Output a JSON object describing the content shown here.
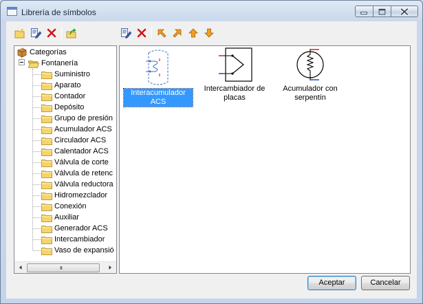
{
  "window": {
    "title": "Librería de símbolos",
    "controls": [
      "minimize-icon",
      "maximize-icon",
      "close-icon"
    ]
  },
  "toolbar_left": [
    "new-folder-icon",
    "edit-icon",
    "delete-icon",
    "import-icon"
  ],
  "toolbar_right": [
    "edit-icon",
    "delete-icon",
    "move-first-icon",
    "move-last-icon",
    "move-up-icon",
    "move-down-icon"
  ],
  "tree": {
    "root": "Categorías",
    "category": "Fontanería",
    "items": [
      "Suministro",
      "Aparato",
      "Contador",
      "Depósito",
      "Grupo de presión",
      "Acumulador ACS",
      "Circulador ACS",
      "Calentador ACS",
      "Válvula de corte",
      "Válvula de retenc",
      "Válvula reductora",
      "Hidromezclador",
      "Conexión",
      "Auxiliar",
      "Generador ACS",
      "Intercambiador",
      "Vaso de expansió"
    ]
  },
  "scrollbar": {
    "grip": "III"
  },
  "symbols": [
    {
      "label": "Interacumulador ACS",
      "selected": true
    },
    {
      "label": "Intercambiador de placas",
      "selected": false
    },
    {
      "label": "Acumulador con serpentín",
      "selected": false
    }
  ],
  "buttons": {
    "ok": "Aceptar",
    "cancel": "Cancelar"
  },
  "colors": {
    "folder": "#f5d56b",
    "selection": "#3399ff",
    "delete": "#d01818",
    "arrow": "#f0a020"
  }
}
